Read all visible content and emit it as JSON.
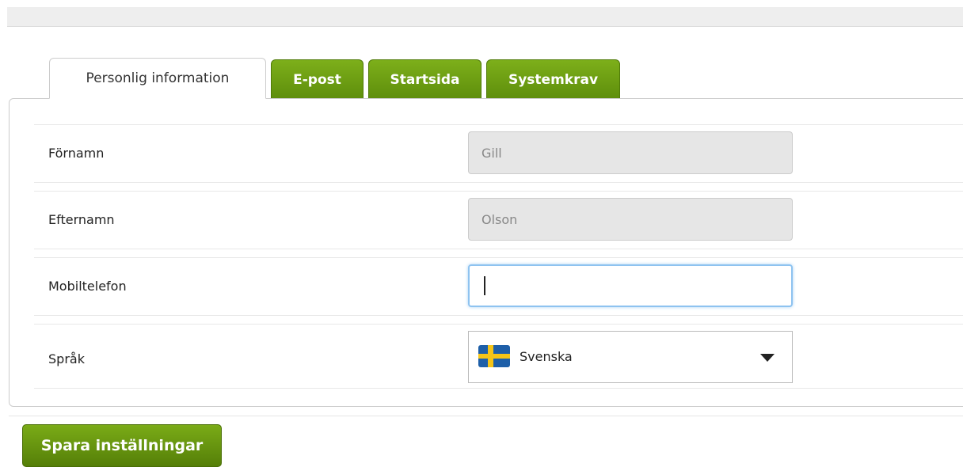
{
  "tabs": [
    {
      "label": "Personlig information",
      "active": true
    },
    {
      "label": "E-post",
      "active": false
    },
    {
      "label": "Startsida",
      "active": false
    },
    {
      "label": "Systemkrav",
      "active": false
    }
  ],
  "form": {
    "first_name": {
      "label": "Förnamn",
      "value": "Gill"
    },
    "last_name": {
      "label": "Efternamn",
      "value": "Olson"
    },
    "mobile": {
      "label": "Mobiltelefon",
      "value": ""
    },
    "language": {
      "label": "Språk",
      "value": "Svenska",
      "flag_icon": "sweden-flag-icon"
    }
  },
  "actions": {
    "save_label": "Spara inställningar"
  },
  "colors": {
    "accent_green": "#6a9b12",
    "focus_blue": "#8ec3f0"
  }
}
